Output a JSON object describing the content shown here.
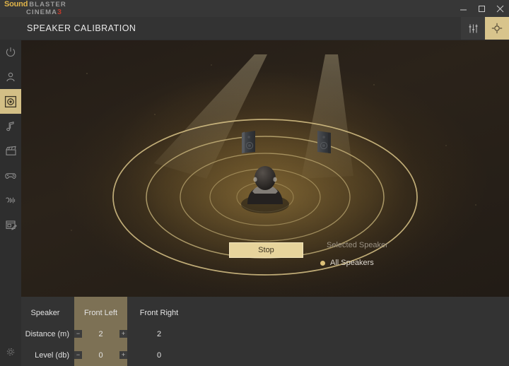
{
  "window": {
    "brand": {
      "sound": "Sound",
      "blaster": "BLASTER",
      "cinema": "CINEMA",
      "version": "3"
    },
    "controls": {
      "minimize": "minimize-button",
      "maximize": "maximize-button",
      "close": "close-button"
    }
  },
  "header": {
    "title": "SPEAKER CALIBRATION",
    "actions": [
      {
        "name": "equalizer-icon",
        "label": "Equalizer"
      },
      {
        "name": "calibration-icon",
        "label": "Calibration",
        "active": true
      }
    ]
  },
  "sidebar": {
    "items": [
      {
        "name": "power-icon",
        "label": "Power",
        "selected": false
      },
      {
        "name": "profile-icon",
        "label": "Profile",
        "selected": false
      },
      {
        "name": "speaker-calibration-icon",
        "label": "Speaker Calibration",
        "selected": true
      },
      {
        "name": "music-icon",
        "label": "Music",
        "selected": false
      },
      {
        "name": "movie-icon",
        "label": "Movie",
        "selected": false
      },
      {
        "name": "game-icon",
        "label": "Game",
        "selected": false
      },
      {
        "name": "voice-icon",
        "label": "Voice",
        "selected": false
      },
      {
        "name": "notes-icon",
        "label": "Notes",
        "selected": false
      }
    ],
    "bottom": {
      "name": "settings-icon",
      "label": "Settings"
    }
  },
  "scene": {
    "speakers": [
      {
        "name": "speaker-front-left",
        "label": "Front Left"
      },
      {
        "name": "speaker-front-right",
        "label": "Front Right"
      }
    ],
    "listener": "listener-silhouette",
    "rings": 5
  },
  "controls": {
    "stop_label": "Stop",
    "selected_speaker_label": "Selected Speaker",
    "radio_label": "All Speakers",
    "radio_selected": true
  },
  "table": {
    "corner_label": "Speaker",
    "columns": [
      {
        "label": "Front Left",
        "highlighted": true
      },
      {
        "label": "Front Right",
        "highlighted": false
      }
    ],
    "rows": [
      {
        "label": "Distance (m)",
        "values": [
          "2",
          "2"
        ]
      },
      {
        "label": "Level (db)",
        "values": [
          "0",
          "0"
        ]
      }
    ],
    "stepper_minus": "−",
    "stepper_plus": "+"
  },
  "colors": {
    "accent": "#d8c48c",
    "accent_bright": "#e7d49c",
    "highlight_column": "#7d7155",
    "brand_gold": "#e0b44a",
    "brand_red": "#c0392b",
    "titlebar": "#373737",
    "headerbar": "#333333",
    "sidebar": "#2e2e2e",
    "ring": "#d9c488"
  }
}
